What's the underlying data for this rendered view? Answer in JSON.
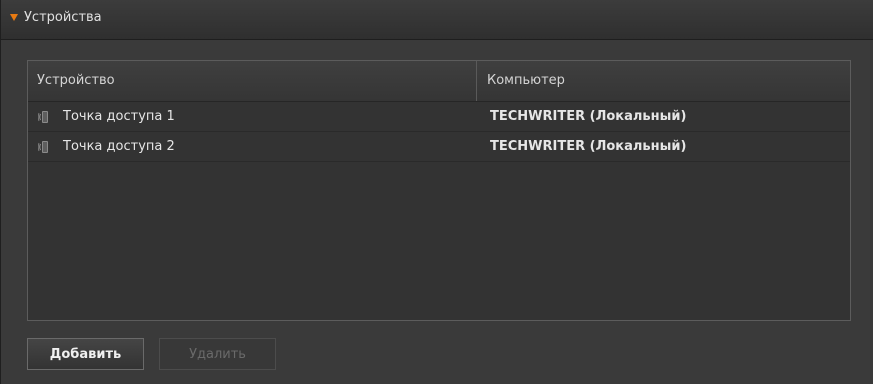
{
  "panel": {
    "title": "Устройства"
  },
  "table": {
    "columns": [
      "Устройство",
      "Компьютер"
    ],
    "rows": [
      {
        "device": "Точка доступа 1",
        "computer": "TECHWRITER (Локальный)",
        "icon": "access-point-icon"
      },
      {
        "device": "Точка доступа 2",
        "computer": "TECHWRITER (Локальный)",
        "icon": "access-point-icon"
      }
    ]
  },
  "buttons": {
    "add_label": "Добавить",
    "remove_label": "Удалить",
    "remove_enabled": false
  },
  "colors": {
    "accent": "#e87a12",
    "background": "#3a3a3a"
  }
}
